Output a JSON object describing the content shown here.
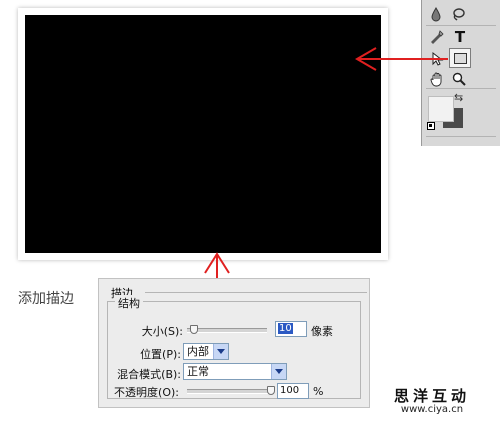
{
  "annotation": {
    "label": "添加描边"
  },
  "dialog": {
    "title": "描边",
    "group": "结构",
    "size": {
      "label": "大小(S):",
      "value": "10",
      "unit": "像素"
    },
    "position": {
      "label": "位置(P):",
      "value": "内部"
    },
    "blend_mode": {
      "label": "混合模式(B):",
      "value": "正常"
    },
    "opacity": {
      "label": "不透明度(O):",
      "value": "100",
      "unit": "%",
      "level": 1.0
    }
  },
  "toolbox": {
    "icons": [
      "drop-icon",
      "lasso-icon",
      "pen-icon",
      "type-icon",
      "path-select-icon",
      "rectangle-tool-icon",
      "hand-icon",
      "zoom-icon",
      "swap-colors-icon",
      "default-colors-icon"
    ],
    "type_glyph": "T",
    "swap_glyph": "⇆"
  },
  "colors": {
    "canvas": "#000000",
    "arrow": "#e02020",
    "foreground": "#f2f2f2",
    "background": "#4a4a4a"
  },
  "watermark": {
    "title": "思洋互动",
    "url": "www.ciya.cn"
  }
}
